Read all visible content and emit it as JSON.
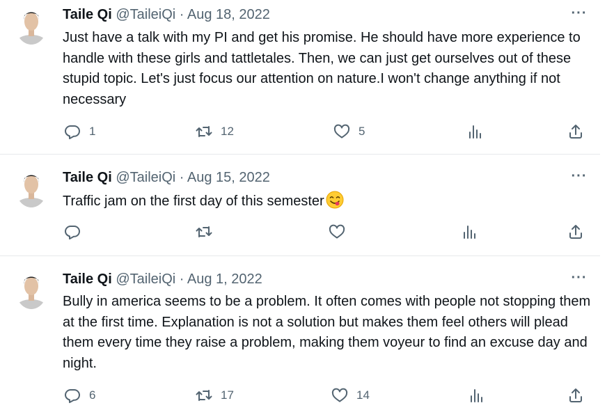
{
  "tweets": [
    {
      "author": "Taile Qi",
      "handle": "@TaileiQi",
      "separator": "·",
      "date": "Aug 18, 2022",
      "text": "Just have a talk with my PI and get his promise. He should have more experience to handle with these girls and tattletales. Then, we can just get ourselves out of these stupid topic. Let's just focus our attention on nature.I  won't change anything if not necessary",
      "replies": "1",
      "retweets": "12",
      "likes": "5"
    },
    {
      "author": "Taile Qi",
      "handle": "@TaileiQi",
      "separator": "·",
      "date": "Aug 15, 2022",
      "text": "Traffic jam on the first day of this semester",
      "emoji": "face-savoring-food-emoji",
      "replies": "",
      "retweets": "",
      "likes": ""
    },
    {
      "author": "Taile Qi",
      "handle": "@TaileiQi",
      "separator": "·",
      "date": "Aug 1, 2022",
      "text": "Bully in america seems to be a problem. It often comes with people not stopping them at the first time. Explanation is not a solution but makes them feel others will plead them every time they raise a problem, making them voyeur to find an excuse day and night.",
      "replies": "6",
      "retweets": "17",
      "likes": "14"
    }
  ],
  "more_label": "···",
  "icons": {
    "reply": "reply-icon",
    "retweet": "retweet-icon",
    "like": "heart-icon",
    "views": "analytics-icon",
    "share": "share-icon",
    "more": "more-icon"
  },
  "colors": {
    "text": "#0f1419",
    "secondary": "#536471",
    "divider": "#e6e9eb",
    "background": "#ffffff"
  }
}
